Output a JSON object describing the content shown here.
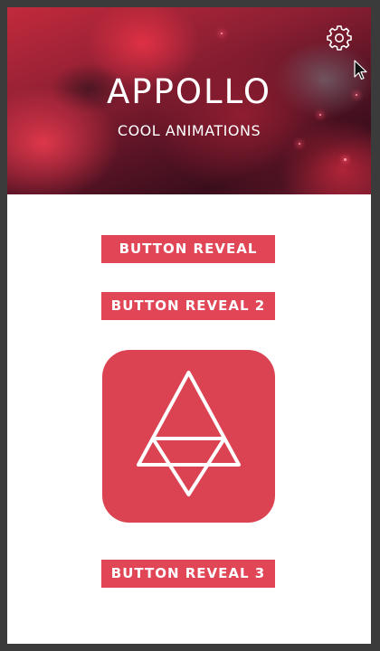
{
  "header": {
    "title": "APPOLLO",
    "subtitle": "COOL ANIMATIONS",
    "settings_icon": "gear-icon"
  },
  "buttons": {
    "reveal_1": "BUTTON REVEAL",
    "reveal_2": "BUTTON REVEAL 2",
    "reveal_3": "BUTTON REVEAL 3"
  },
  "app_icon": {
    "icon": "triangle-logo-icon"
  },
  "colors": {
    "accent": "#e04656",
    "icon_bg": "#dc4352",
    "background": "#ffffff",
    "frame": "#3b3b3b"
  }
}
